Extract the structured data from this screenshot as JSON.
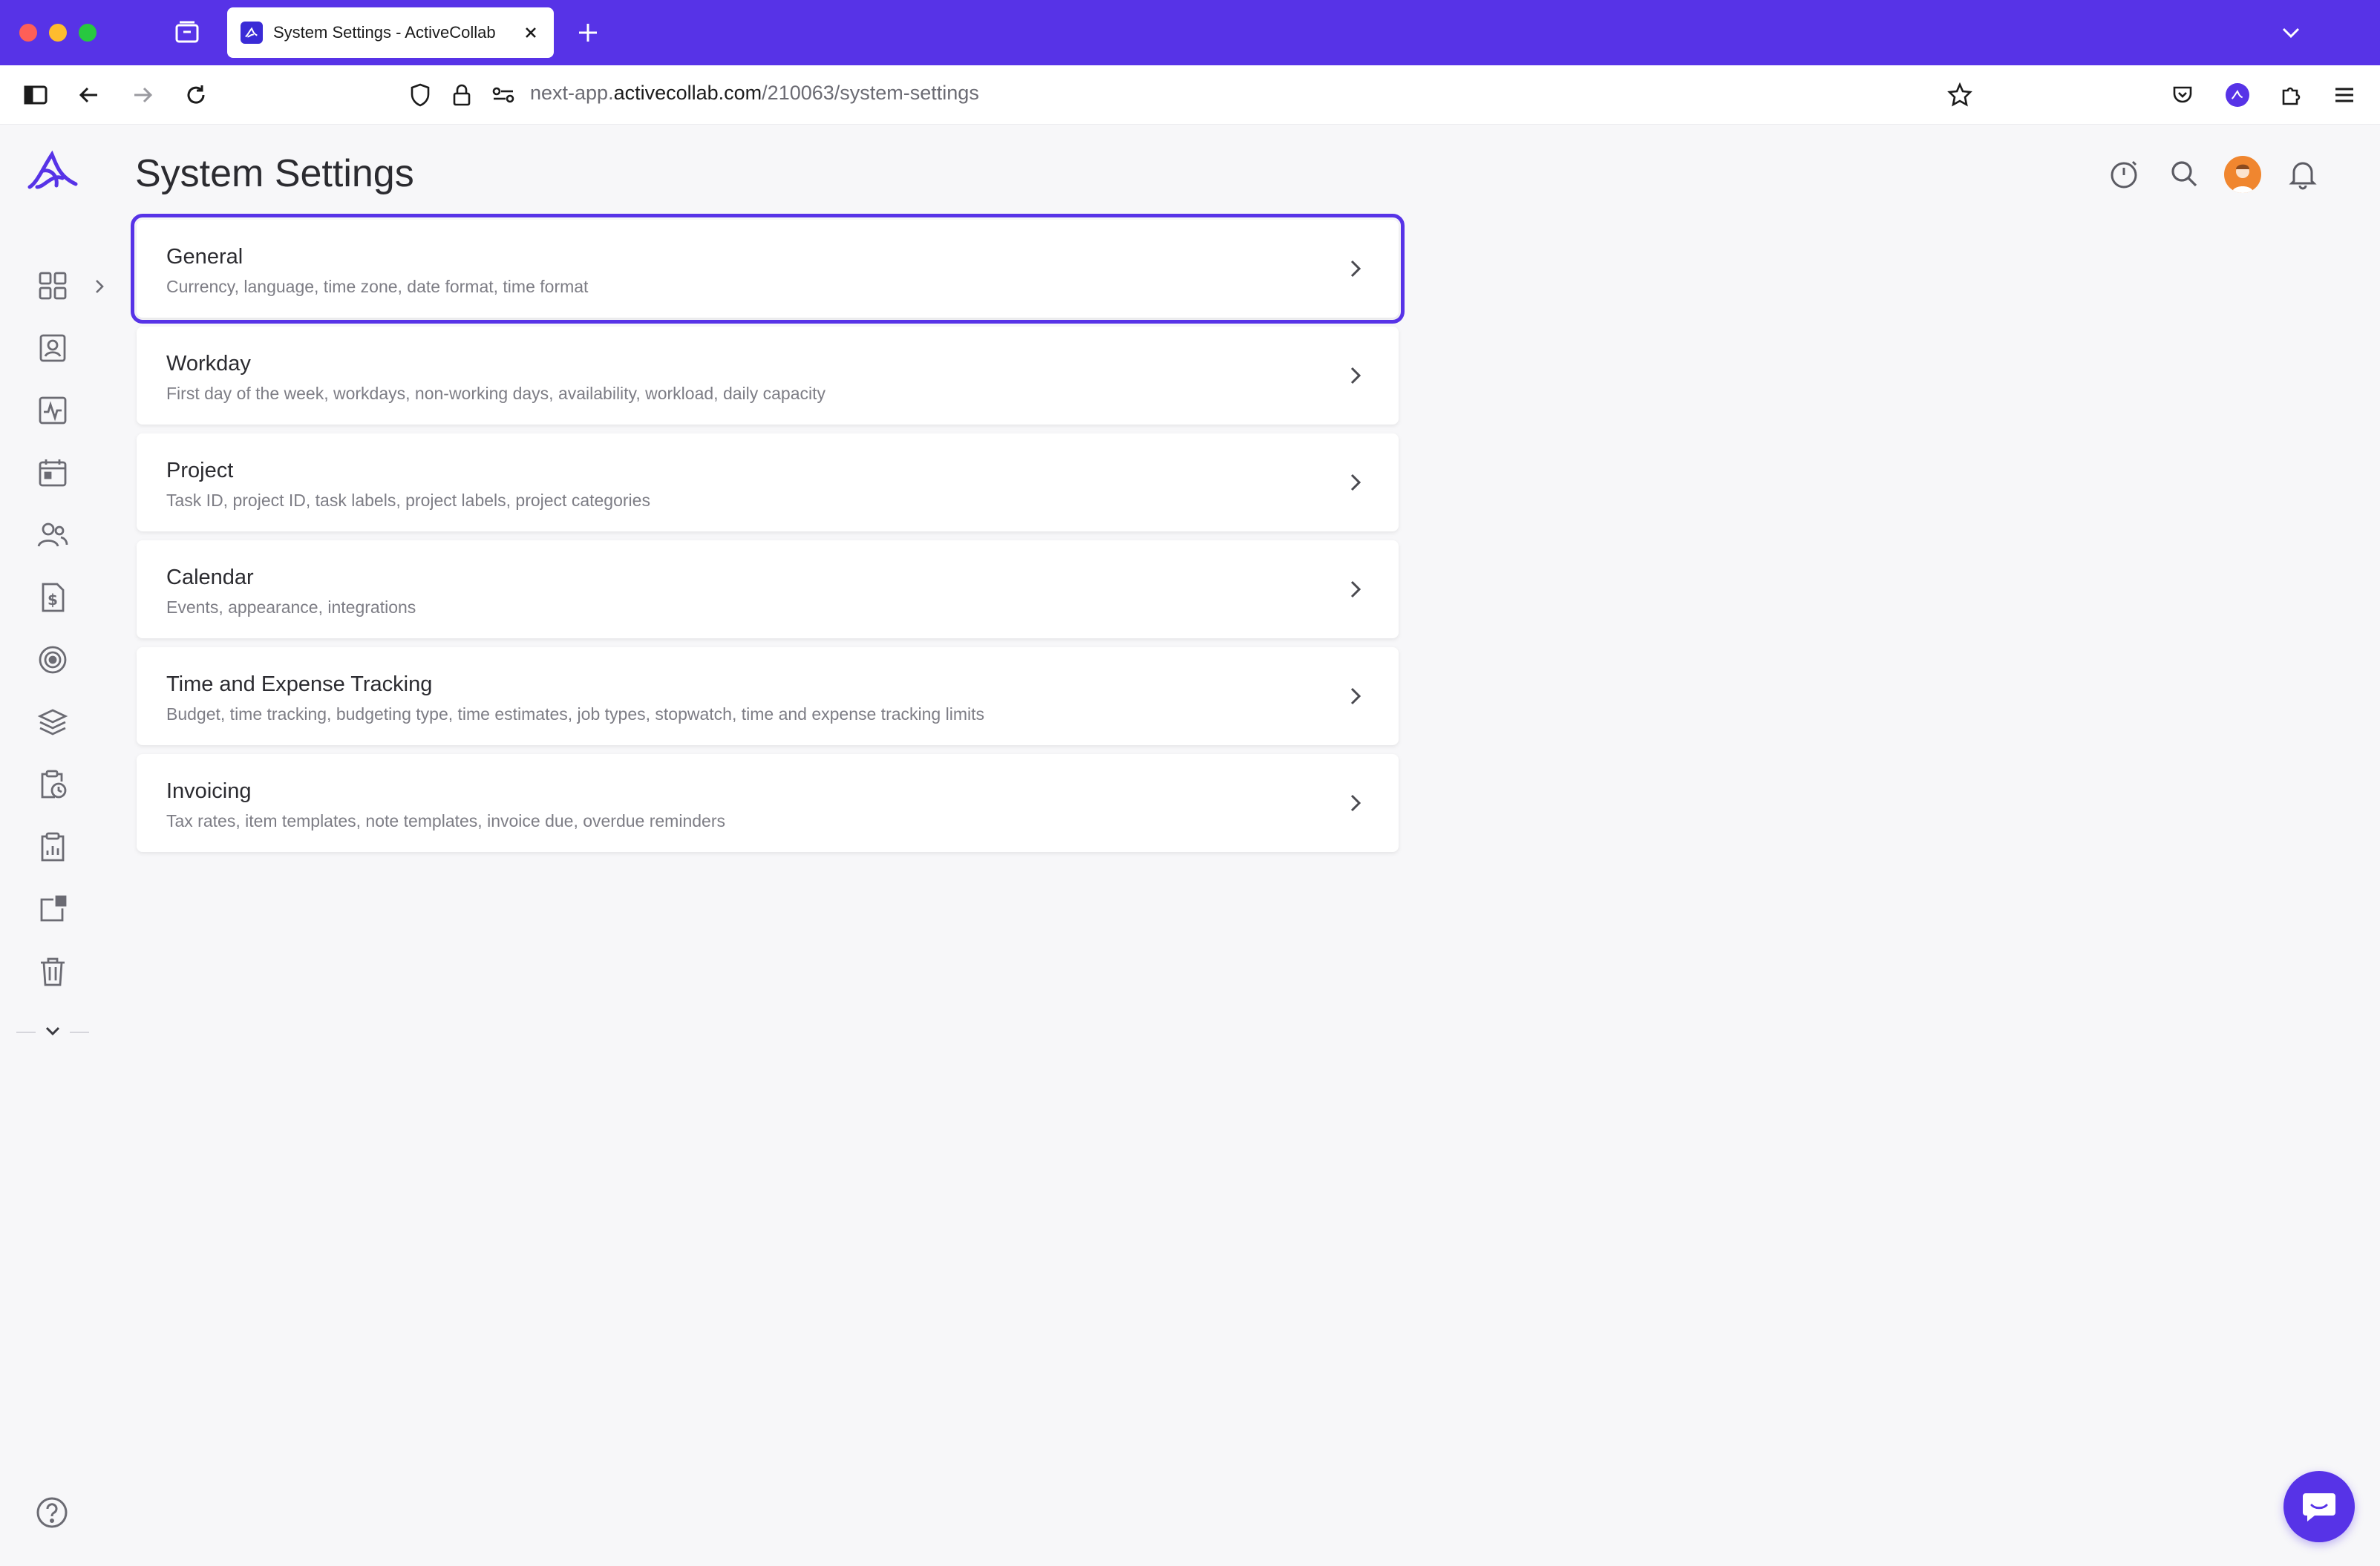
{
  "browser": {
    "tab_title": "System Settings - ActiveCollab",
    "url_prefix": "next-app.",
    "url_host": "activecollab.com",
    "url_path": "/210063/system-settings"
  },
  "page": {
    "title": "System Settings"
  },
  "settings": [
    {
      "title": "General",
      "description": "Currency, language, time zone, date format, time format",
      "selected": true
    },
    {
      "title": "Workday",
      "description": "First day of the week, workdays, non-working days, availability, workload, daily capacity",
      "selected": false
    },
    {
      "title": "Project",
      "description": "Task ID, project ID, task labels, project labels, project categories",
      "selected": false
    },
    {
      "title": "Calendar",
      "description": "Events, appearance, integrations",
      "selected": false
    },
    {
      "title": "Time and Expense Tracking",
      "description": "Budget, time tracking, budgeting type, time estimates, job types, stopwatch, time and expense tracking limits",
      "selected": false
    },
    {
      "title": "Invoicing",
      "description": "Tax rates, item templates, note templates, invoice due, overdue reminders",
      "selected": false
    }
  ],
  "sidebar_icons": [
    "dashboard-icon",
    "my-work-icon",
    "activity-icon",
    "calendar-icon",
    "people-icon",
    "invoices-icon",
    "goals-icon",
    "projects-stack-icon",
    "timesheet-icon",
    "reports-icon",
    "add-on-icon",
    "trash-icon"
  ],
  "colors": {
    "brand": "#5733e7",
    "background": "#f7f7f9"
  }
}
